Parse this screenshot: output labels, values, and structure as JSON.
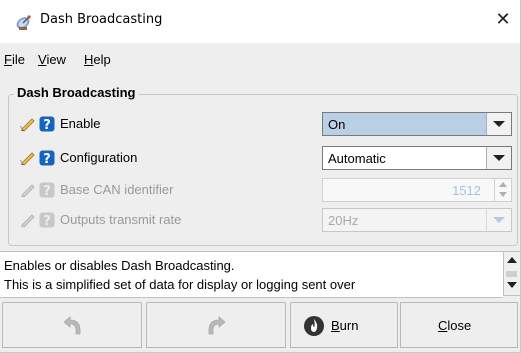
{
  "window": {
    "title": "Dash Broadcasting",
    "title_icon": "satellite-dish-icon",
    "close_glyph": "✕"
  },
  "menu": {
    "items": [
      {
        "mnemonic": "F",
        "rest": "ile"
      },
      {
        "mnemonic": "V",
        "rest": "iew"
      },
      {
        "mnemonic": "H",
        "rest": "elp"
      }
    ]
  },
  "group": {
    "title": "Dash Broadcasting"
  },
  "fields": {
    "enable": {
      "label": "Enable",
      "value": "On"
    },
    "configuration": {
      "label": "Configuration",
      "value": "Automatic"
    },
    "base_can": {
      "label": "Base CAN identifier",
      "value": "1512"
    },
    "transmit_rate": {
      "label": "Outputs transmit rate",
      "value": "20Hz"
    }
  },
  "description": {
    "line1": "Enables or disables Dash Broadcasting.",
    "line2": "This is a simplified set of data for display or logging sent over"
  },
  "buttons": {
    "burn": {
      "mnemonic": "B",
      "rest": "urn"
    },
    "close": {
      "mnemonic": "C",
      "rest": "lose"
    }
  },
  "colors": {
    "help_icon_blue": "#1565c0",
    "selected_combo": "#b8cfe5",
    "disabled_text": "#9a9a9a"
  }
}
